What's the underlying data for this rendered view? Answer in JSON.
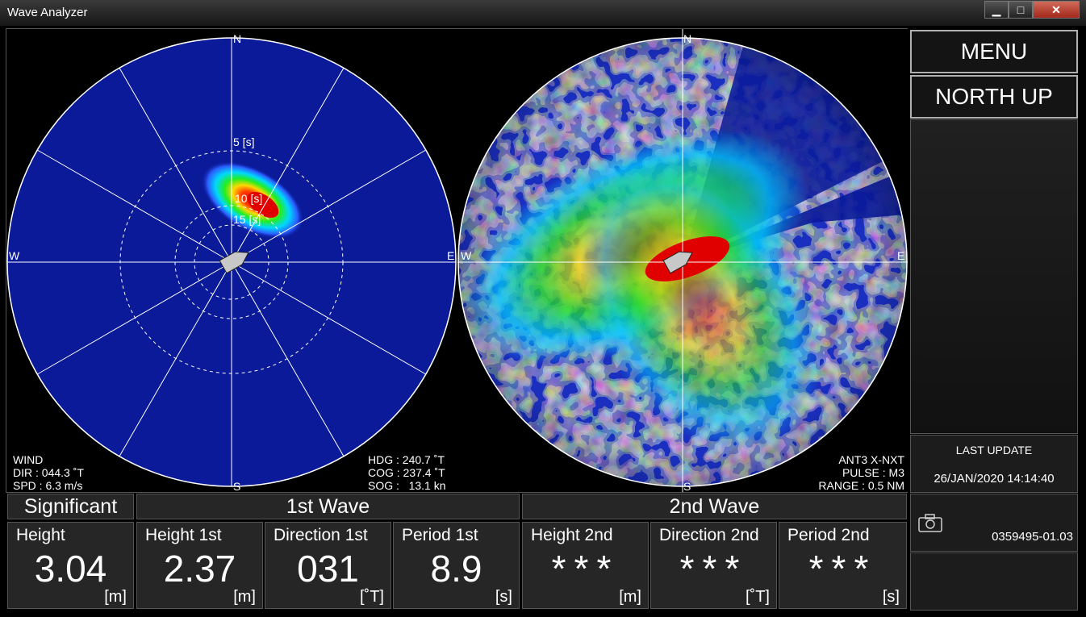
{
  "window": {
    "title": "Wave Analyzer",
    "minimize": "▁",
    "maximize": "□",
    "close": "✕"
  },
  "spectrum": {
    "compass": {
      "n": "N",
      "s": "S",
      "e": "E",
      "w": "W"
    },
    "rings": [
      "5 [s]",
      "10 [s]",
      "15 [s]"
    ],
    "wind": {
      "title": "WIND",
      "dir": "DIR : 044.3 ˚T",
      "spd": "SPD : 6.3 m/s"
    },
    "nav": {
      "hdg": "HDG : 240.7 ˚T",
      "cog": "COG : 237.4 ˚T",
      "sog": "SOG :   13.1 kn"
    }
  },
  "radar": {
    "compass": {
      "n": "N",
      "s": "S",
      "e": "E",
      "w": "W"
    },
    "antenna": "ANT3 X-NXT",
    "pulse": "PULSE : M3",
    "range": "RANGE : 0.5 NM"
  },
  "sidebar": {
    "menu": "MENU",
    "north_up": "NORTH UP",
    "last_update_label": "LAST UPDATE",
    "last_update_value": "26/JAN/2020 14:14:40",
    "version": "0359495-01.03",
    "camera_icon": "camera-icon"
  },
  "waves": {
    "headers": {
      "significant": "Significant",
      "first": "1st Wave",
      "second": "2nd Wave"
    },
    "cells": [
      {
        "label": "Height",
        "value": "3.04",
        "unit": "[m]"
      },
      {
        "label": "Height 1st",
        "value": "2.37",
        "unit": "[m]"
      },
      {
        "label": "Direction 1st",
        "value": "031",
        "unit": "[˚T]"
      },
      {
        "label": "Period 1st",
        "value": "8.9",
        "unit": "[s]"
      },
      {
        "label": "Height 2nd",
        "value": "***",
        "unit": "[m]"
      },
      {
        "label": "Direction 2nd",
        "value": "***",
        "unit": "[˚T]"
      },
      {
        "label": "Period 2nd",
        "value": "***",
        "unit": "[s]"
      }
    ]
  },
  "colors": {
    "ocean": "#0a1a99",
    "accent_red": "#e00000"
  }
}
